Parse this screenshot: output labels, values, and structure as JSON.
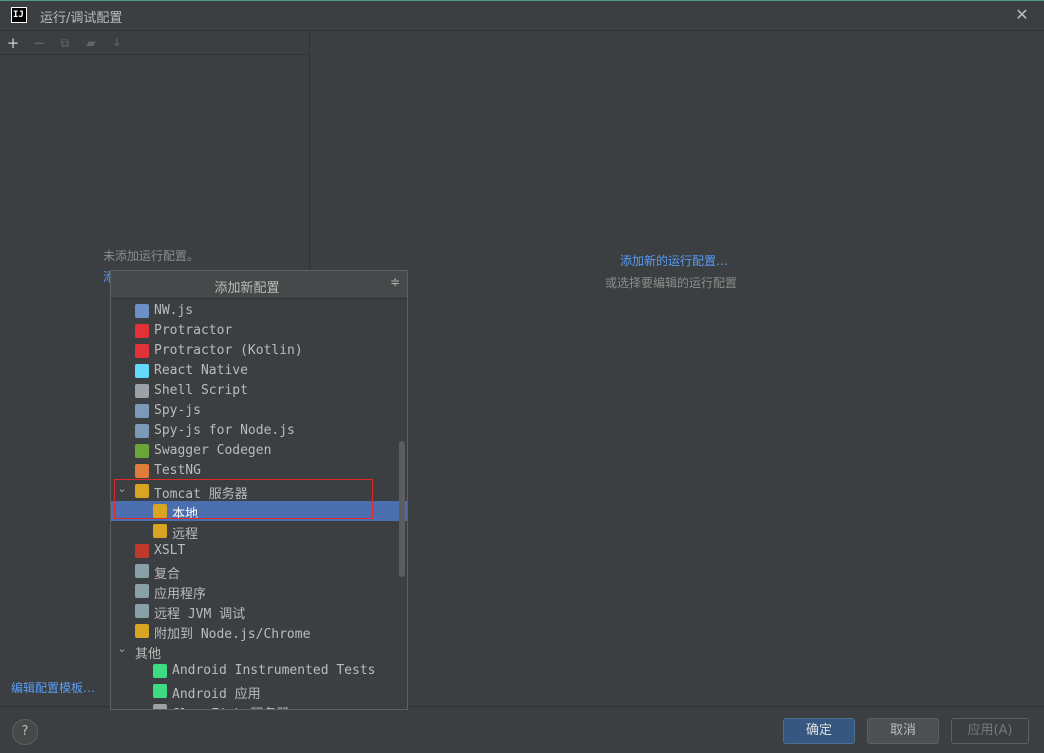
{
  "window": {
    "title": "运行/调试配置"
  },
  "left": {
    "empty_message": "未添加运行配置。",
    "add_link_partial": "添",
    "edit_templates": "编辑配置模板…"
  },
  "right": {
    "add_new_link": "添加新的运行配置…",
    "or_select": "或选择要编辑的运行配置"
  },
  "popup": {
    "title": "添加新配置",
    "items": [
      {
        "label": "NW.js",
        "icon": "nwjs-icon",
        "color": "#6b8fc7",
        "indent": 0,
        "arrow": ""
      },
      {
        "label": "Protractor",
        "icon": "protractor-icon",
        "color": "#e23237",
        "indent": 0,
        "arrow": ""
      },
      {
        "label": "Protractor (Kotlin)",
        "icon": "protractor-icon",
        "color": "#e23237",
        "indent": 0,
        "arrow": ""
      },
      {
        "label": "React Native",
        "icon": "react-icon",
        "color": "#61dafb",
        "indent": 0,
        "arrow": ""
      },
      {
        "label": "Shell Script",
        "icon": "shell-icon",
        "color": "#9aa2a8",
        "indent": 0,
        "arrow": ""
      },
      {
        "label": "Spy-js",
        "icon": "spyjs-icon",
        "color": "#7b9ab8",
        "indent": 0,
        "arrow": ""
      },
      {
        "label": "Spy-js for Node.js",
        "icon": "spyjs-icon",
        "color": "#7b9ab8",
        "indent": 0,
        "arrow": ""
      },
      {
        "label": "Swagger Codegen",
        "icon": "swagger-icon",
        "color": "#6ba539",
        "indent": 0,
        "arrow": ""
      },
      {
        "label": "TestNG",
        "icon": "testng-icon",
        "color": "#e07b39",
        "indent": 0,
        "arrow": ""
      },
      {
        "label": "Tomcat 服务器",
        "icon": "tomcat-icon",
        "color": "#d9a520",
        "indent": 0,
        "arrow": "v"
      },
      {
        "label": "本地",
        "icon": "tomcat-icon",
        "color": "#d9a520",
        "indent": 1,
        "arrow": "",
        "selected": true
      },
      {
        "label": "远程",
        "icon": "tomcat-icon",
        "color": "#d9a520",
        "indent": 1,
        "arrow": ""
      },
      {
        "label": "XSLT",
        "icon": "xslt-icon",
        "color": "#c0392b",
        "indent": 0,
        "arrow": ""
      },
      {
        "label": "复合",
        "icon": "compound-icon",
        "color": "#8aa0a8",
        "indent": 0,
        "arrow": ""
      },
      {
        "label": "应用程序",
        "icon": "application-icon",
        "color": "#8aa0a8",
        "indent": 0,
        "arrow": ""
      },
      {
        "label": "远程 JVM 调试",
        "icon": "remote-debug-icon",
        "color": "#8aa0a8",
        "indent": 0,
        "arrow": ""
      },
      {
        "label": "附加到 Node.js/Chrome",
        "icon": "attach-icon",
        "color": "#d9a520",
        "indent": 0,
        "arrow": ""
      },
      {
        "label": "其他",
        "icon": "",
        "color": "",
        "indent": -1,
        "arrow": "v"
      },
      {
        "label": "Android Instrumented Tests",
        "icon": "android-icon",
        "color": "#3ddc84",
        "indent": 1,
        "arrow": ""
      },
      {
        "label": "Android 应用",
        "icon": "android-icon",
        "color": "#3ddc84",
        "indent": 1,
        "arrow": ""
      },
      {
        "label": "GlassFish 服务器",
        "icon": "glassfish-icon",
        "color": "#a0a0a0",
        "indent": 1,
        "arrow": "v"
      }
    ]
  },
  "buttons": {
    "ok": "确定",
    "cancel": "取消",
    "apply": "应用(A)",
    "help": "?"
  }
}
